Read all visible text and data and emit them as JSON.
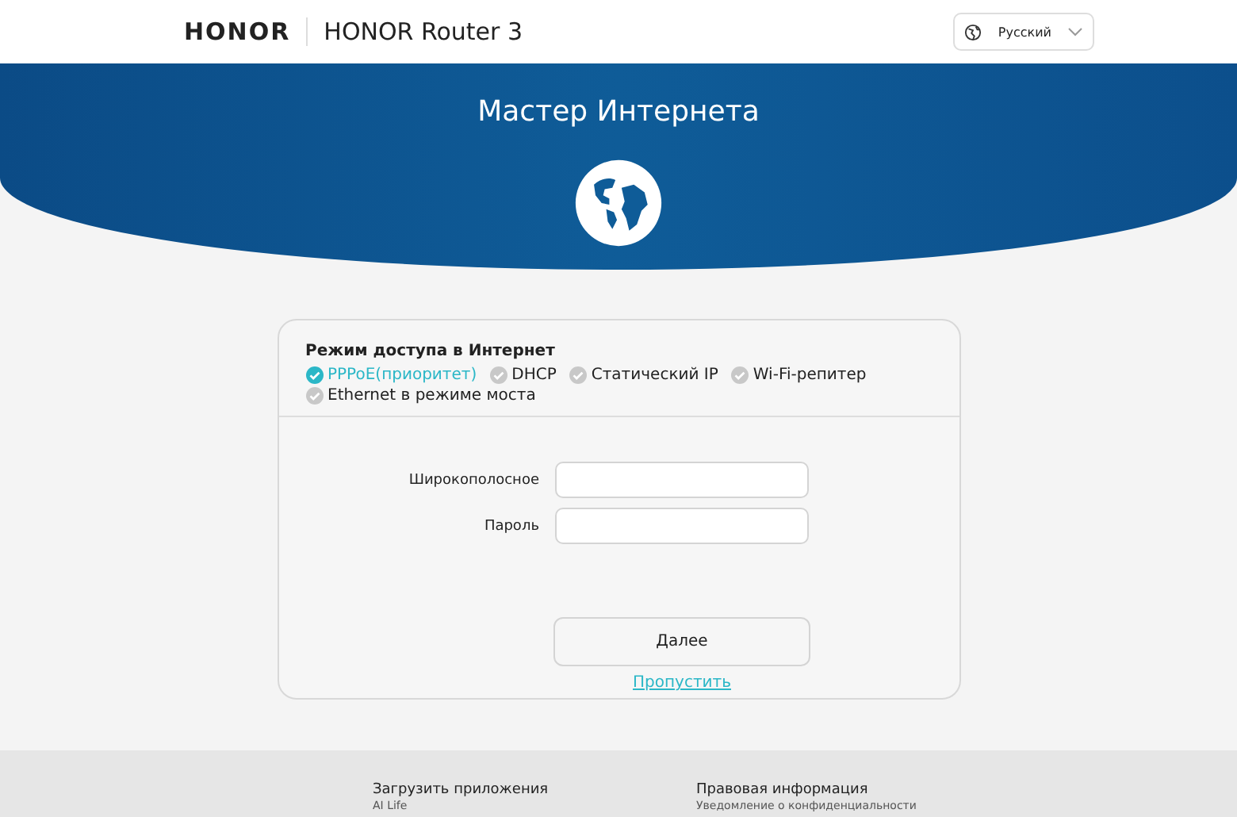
{
  "header": {
    "brand": "HONOR",
    "product": "HONOR Router 3",
    "language": "Русский"
  },
  "banner": {
    "title": "Мастер Интернета"
  },
  "access": {
    "title": "Режим доступа в Интернет",
    "modes": [
      {
        "label": "PPPoE(приоритет)",
        "selected": true
      },
      {
        "label": "DHCP",
        "selected": false
      },
      {
        "label": "Статический IP",
        "selected": false
      },
      {
        "label": "Wi-Fi-репитер",
        "selected": false
      },
      {
        "label": "Ethernet в режиме моста",
        "selected": false
      }
    ]
  },
  "fields": [
    {
      "label": "Широкополосное"
    },
    {
      "label": "Пароль"
    }
  ],
  "next_button": "Далее",
  "skip_link": "Пропустить",
  "footer": {
    "columns": [
      {
        "title": "Загрузить приложения",
        "links": [
          "AI Life"
        ]
      },
      {
        "title": "Правовая информация",
        "links": [
          "Уведомление о конфиденциальности"
        ]
      }
    ]
  }
}
